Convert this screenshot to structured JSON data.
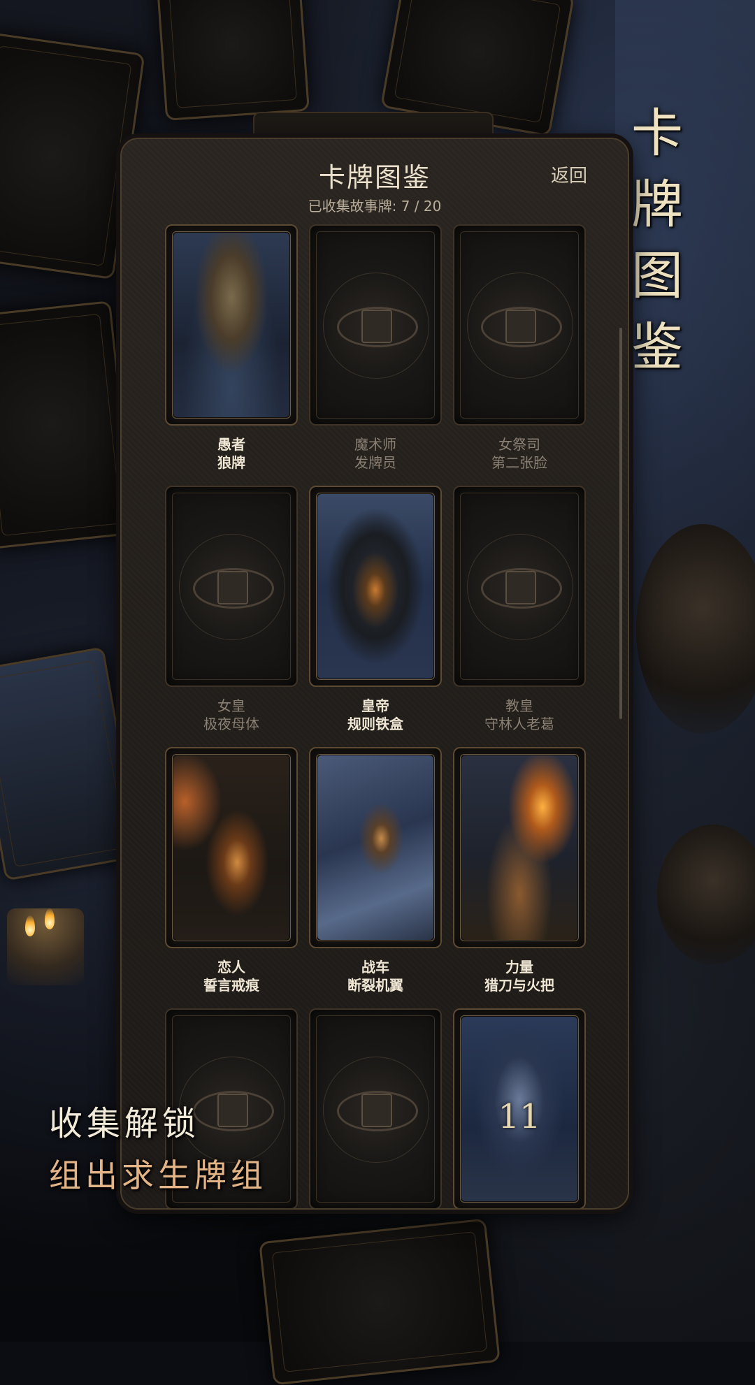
{
  "side_title": [
    "卡",
    "牌",
    "图",
    "鉴"
  ],
  "panel": {
    "title": "卡牌图鉴",
    "back_label": "返回",
    "progress_text": "已收集故事牌: 7 / 20"
  },
  "cards": [
    {
      "name": "愚者",
      "subtitle": "狼牌",
      "unlocked": true,
      "art": "fool"
    },
    {
      "name": "魔术师",
      "subtitle": "发牌员",
      "unlocked": false
    },
    {
      "name": "女祭司",
      "subtitle": "第二张脸",
      "unlocked": false
    },
    {
      "name": "女皇",
      "subtitle": "极夜母体",
      "unlocked": false
    },
    {
      "name": "皇帝",
      "subtitle": "规则铁盒",
      "unlocked": true,
      "art": "emperor"
    },
    {
      "name": "教皇",
      "subtitle": "守林人老葛",
      "unlocked": false
    },
    {
      "name": "恋人",
      "subtitle": "誓言戒痕",
      "unlocked": true,
      "art": "lovers"
    },
    {
      "name": "战车",
      "subtitle": "断裂机翼",
      "unlocked": true,
      "art": "chariot"
    },
    {
      "name": "力量",
      "subtitle": "猎刀与火把",
      "unlocked": true,
      "art": "strength"
    },
    {
      "name": "",
      "subtitle": "",
      "unlocked": false
    },
    {
      "name": "",
      "subtitle": "",
      "unlocked": false
    },
    {
      "name": "",
      "subtitle": "",
      "unlocked": true,
      "art": "justice",
      "numeral": "11"
    }
  ],
  "promo": {
    "line1": "收集解锁",
    "line2": "组出求生牌组"
  },
  "colors": {
    "panel_bg": "#221e1a",
    "panel_border": "#4a3d2c",
    "text_primary": "#efe6d4",
    "text_locked": "#8a8074",
    "promo_accent": "#e3b486"
  }
}
